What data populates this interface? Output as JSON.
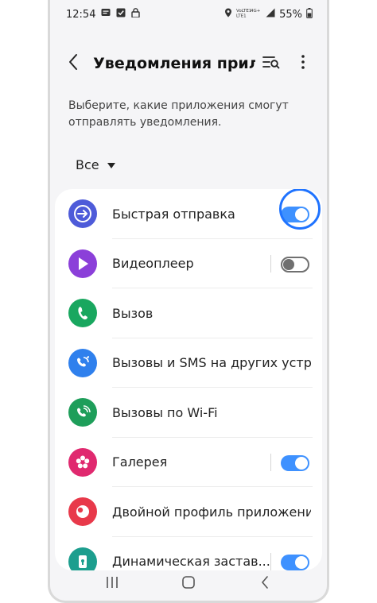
{
  "status_bar": {
    "time": "12:54",
    "network": "VoLTE1 4G+",
    "battery": "55%"
  },
  "header": {
    "title": "Уведомления прило..."
  },
  "description": "Выберите, какие приложения смогут отправлять уведомления.",
  "filter": {
    "selected": "Все"
  },
  "colors": {
    "accent": "#3e91ff",
    "highlight": "#1f73ff"
  },
  "apps": [
    {
      "label": "Быстрая отправка",
      "icon": "quick-share-icon",
      "toggle": "on",
      "highlighted": true
    },
    {
      "label": "Видеоплеер",
      "icon": "video-player-icon",
      "toggle": "off"
    },
    {
      "label": "Вызов",
      "icon": "phone-icon",
      "toggle": "none"
    },
    {
      "label": "Вызовы и SMS на других устр...",
      "icon": "calls-sms-other-devices-icon",
      "toggle": "none"
    },
    {
      "label": "Вызовы по Wi-Fi",
      "icon": "wifi-calling-icon",
      "toggle": "none"
    },
    {
      "label": "Галерея",
      "icon": "gallery-icon",
      "toggle": "on"
    },
    {
      "label": "Двойной профиль приложений",
      "icon": "dual-messenger-icon",
      "toggle": "none"
    },
    {
      "label": "Динамическая застав...",
      "icon": "dynamic-lock-screen-icon",
      "toggle": "on"
    }
  ]
}
